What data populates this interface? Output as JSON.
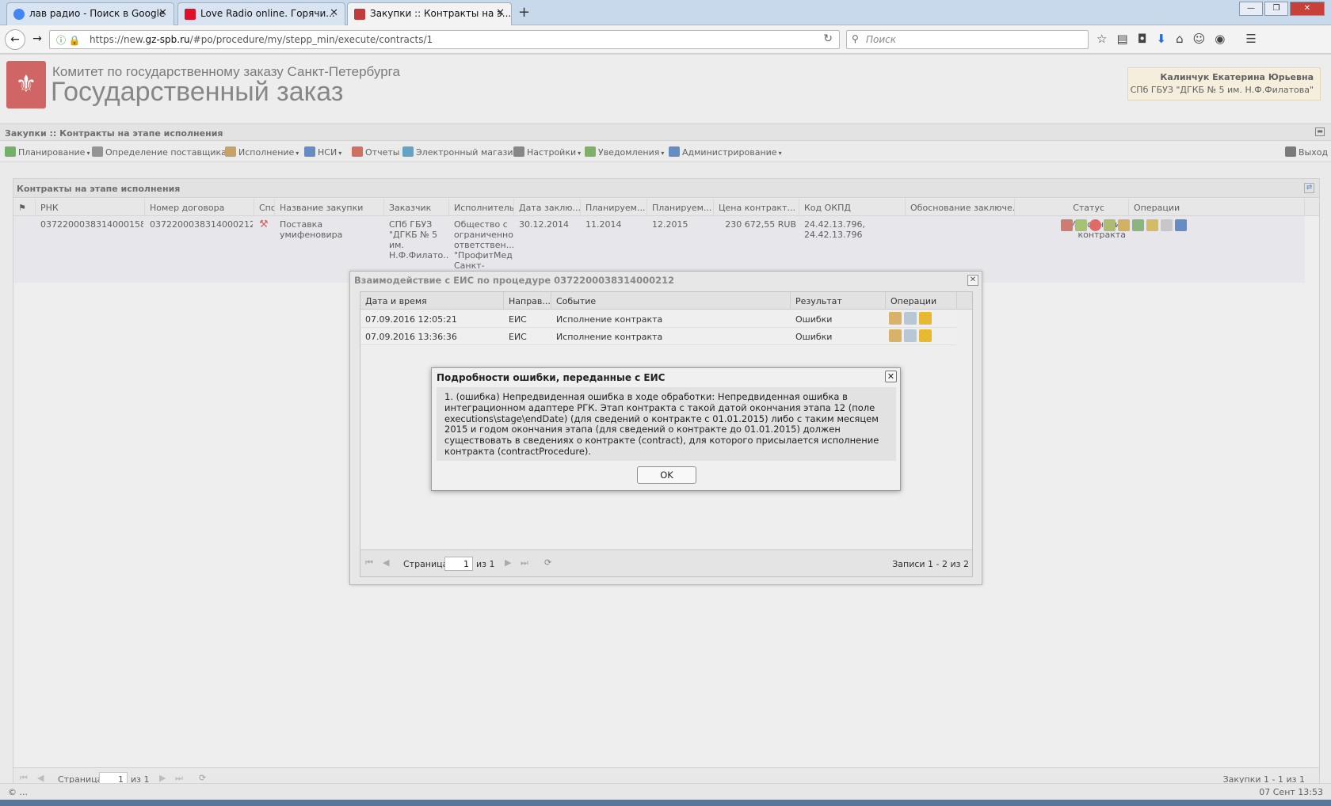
{
  "browser": {
    "tabs": [
      {
        "label": "лав радио - Поиск в Google",
        "icon_color": "#4285f4"
      },
      {
        "label": "Love Radio online. Горячи...",
        "icon_color": "#e0102a"
      },
      {
        "label": "Закупки :: Контракты на э...",
        "icon_color": "#c33a3a"
      }
    ],
    "url_prefix": "https://new.",
    "url_domain": "gz-spb.ru",
    "url_path": "/#po/procedure/my/stepp_min/execute/contracts/1",
    "search_placeholder": "Поиск"
  },
  "header": {
    "org_name": "Комитет по государственному заказу Санкт-Петербурга",
    "site_title": "Государственный заказ",
    "user_name": "Калинчук Екатерина Юрьевна",
    "user_org": "СПб ГБУЗ \"ДГКБ № 5 им. Н.Ф.Филатова\""
  },
  "app_title": "Закупки :: Контракты на этапе исполнения",
  "menu": [
    {
      "label": "Планирование",
      "color": "#4e9a3a"
    },
    {
      "label": "Определение поставщика",
      "color": "#777777"
    },
    {
      "label": "Исполнение",
      "color": "#b58a3a"
    },
    {
      "label": "НСИ",
      "color": "#3a6cb5"
    },
    {
      "label": "Отчеты",
      "color": "#c04a3a"
    },
    {
      "label": "Электронный магазин",
      "color": "#3a8ab5"
    },
    {
      "label": "Настройки",
      "color": "#666666"
    },
    {
      "label": "Уведомления",
      "color": "#5a9a3a"
    },
    {
      "label": "Администрирование",
      "color": "#3a6cb5"
    }
  ],
  "exit_label": "Выход",
  "contracts": {
    "title": "Контракты на этапе исполнения",
    "columns": [
      "РНК",
      "Номер договора",
      "Спо",
      "Название закупки",
      "Заказчик",
      "Исполнитель",
      "Дата заклю...",
      "Планируем...",
      "Планируем...",
      "Цена контракт...",
      "Код ОКПД",
      "Обоснование заключе...",
      "Статус",
      "Операции"
    ],
    "row": {
      "rnk": "0372200038314000158",
      "contract_no": "0372200038314000212...",
      "purchase_name": "Поставка умифеновира",
      "customer": "СПб ГБУЗ \"ДГКБ № 5 им. Н.Ф.Филато...",
      "supplier": "Общество с ограниченной ответствен... \"ПрофитМед Санкт-",
      "date": "30.12.2014",
      "plan1": "11.2014",
      "plan2": "12.2015",
      "price": "230 672,55 RUB",
      "okpd": "24.42.13.796, 24.42.13.796",
      "status": "Исполнение контракта"
    },
    "pager": {
      "page_label": "Страница",
      "page": "1",
      "of": "из 1",
      "summary": "Закупки 1 - 1 из 1"
    }
  },
  "eis_dialog": {
    "title": "Взаимодействие с ЕИС по процедуре 0372200038314000212",
    "columns": [
      "Дата и время",
      "Направ...",
      "Событие",
      "Результат",
      "Операции"
    ],
    "rows": [
      {
        "datetime": "07.09.2016 12:05:21",
        "direction": "ЕИС",
        "event": "Исполнение контракта",
        "result": "Ошибки"
      },
      {
        "datetime": "07.09.2016 13:36:36",
        "direction": "ЕИС",
        "event": "Исполнение контракта",
        "result": "Ошибки"
      }
    ],
    "pager": {
      "page_label": "Страница",
      "page": "1",
      "of": "из 1",
      "summary": "Записи 1 - 2 из 2"
    }
  },
  "error_dialog": {
    "title": "Подробности ошибки, переданные с ЕИС",
    "message": "1. (ошибка) Непредвиденная ошибка в ходе обработки: Непредвиденная ошибка в интеграционном адаптере РГК. Этап контракта с такой датой окончания этапа 12 (поле executions\\stage\\endDate) (для сведений о контракте с 01.01.2015) либо с таким месяцем 2015 и годом окончания этапа (для сведений о контракте до 01.01.2015) должен существовать в сведениях о контракте (contract), для которого присылается исполнение контракта (contractProcedure).",
    "ok_label": "OK"
  },
  "statusbar": {
    "left": "© ...",
    "right": "07 Сент 13:53"
  }
}
